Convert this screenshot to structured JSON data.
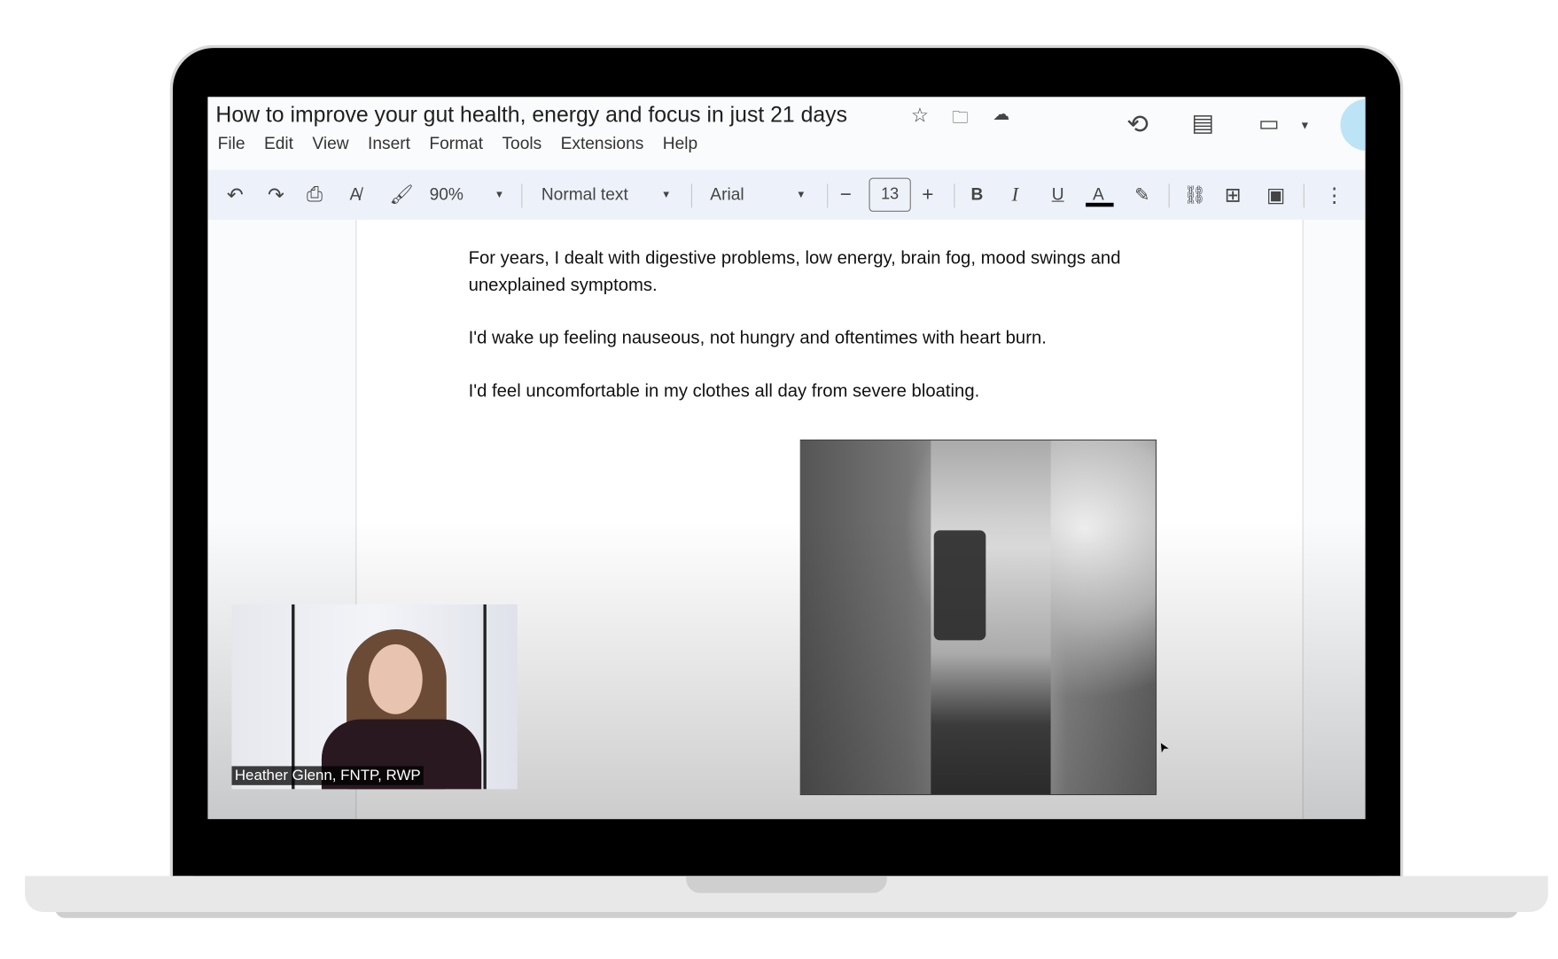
{
  "document": {
    "title": "How to improve your gut health, energy and focus in just 21 days",
    "menu": [
      "File",
      "Edit",
      "View",
      "Insert",
      "Format",
      "Tools",
      "Extensions",
      "Help"
    ],
    "paragraphs": [
      "For years, I dealt with digestive problems, low energy, brain fog, mood swings and unexplained symptoms.",
      "I'd wake up feeling nauseous, not hungry and oftentimes with heart burn.",
      "I'd feel uncomfortable in my clothes all day from severe bloating."
    ]
  },
  "toolbar": {
    "zoom": "90%",
    "style": "Normal text",
    "font": "Arial",
    "font_size": "13",
    "bold": "B",
    "italic": "I",
    "underline": "U",
    "text_color": "A"
  },
  "video": {
    "caption": "Heather Glenn, FNTP, RWP"
  },
  "icons": [
    "star-icon",
    "move-folder-icon",
    "cloud-status-icon",
    "history-icon",
    "comments-icon",
    "meet-icon",
    "undo-icon",
    "redo-icon",
    "print-icon",
    "spellcheck-icon",
    "paint-format-icon",
    "link-icon",
    "add-comment-icon",
    "image-icon",
    "more-icon"
  ]
}
